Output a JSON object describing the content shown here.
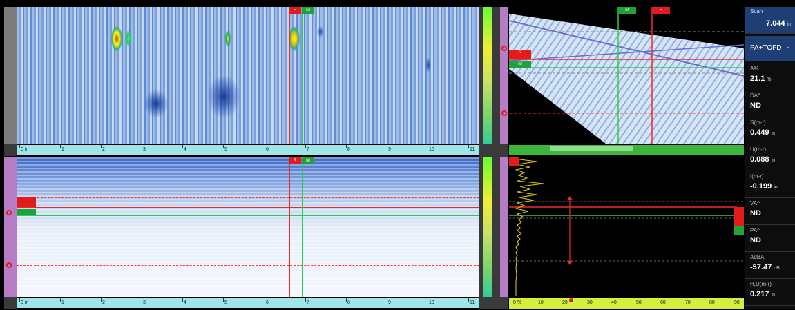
{
  "colors": {
    "accent_red": "#e31b1b",
    "accent_green": "#1da33a",
    "panel_blue": "#1e3f75",
    "scale_cyan": "#9ee6ea",
    "scale_yellow": "#d6ef3a"
  },
  "cursor_tags": {
    "c_red": "R",
    "c_green": "M",
    "b_red": "R",
    "b_green": "M",
    "s_red": "R",
    "s_green": "M",
    "s_top_green": "M",
    "s_top_red": "R"
  },
  "cscan_scale": {
    "labels": [
      "0 in",
      "1",
      "2",
      "3",
      "4",
      "5",
      "6",
      "7",
      "8",
      "9",
      "10",
      "11"
    ]
  },
  "bscan_scale": {
    "labels": [
      "0 in",
      "1",
      "2",
      "3",
      "4",
      "5",
      "6",
      "7",
      "8",
      "9",
      "10",
      "11"
    ]
  },
  "ascan_scale": {
    "labels": [
      "0 %",
      "10",
      "20",
      "30",
      "40",
      "50",
      "60",
      "70",
      "80",
      "90"
    ]
  },
  "side_panel": {
    "scan_label": "Scan",
    "scan_value": "7.044",
    "scan_unit": "in",
    "group_select": "PA+TOFD",
    "group_chevron_icon": "chevron-down-icon",
    "readings": [
      {
        "label": "A%",
        "value": "21.1",
        "unit": "%"
      },
      {
        "label": "DA^",
        "value": "ND",
        "unit": ""
      },
      {
        "label": "S(m-r)",
        "value": "0.449",
        "unit": "in"
      },
      {
        "label": "U(m-r)",
        "value": "0.088",
        "unit": "in"
      },
      {
        "label": "I(m-r)",
        "value": "-0.199",
        "unit": "in"
      },
      {
        "label": "VA^",
        "value": "ND",
        "unit": ""
      },
      {
        "label": "PA^",
        "value": "ND",
        "unit": ""
      },
      {
        "label": "AdBA",
        "value": "-57.47",
        "unit": "dB"
      },
      {
        "label": "H,U(m-r)",
        "value": "0.217",
        "unit": "in"
      }
    ]
  }
}
